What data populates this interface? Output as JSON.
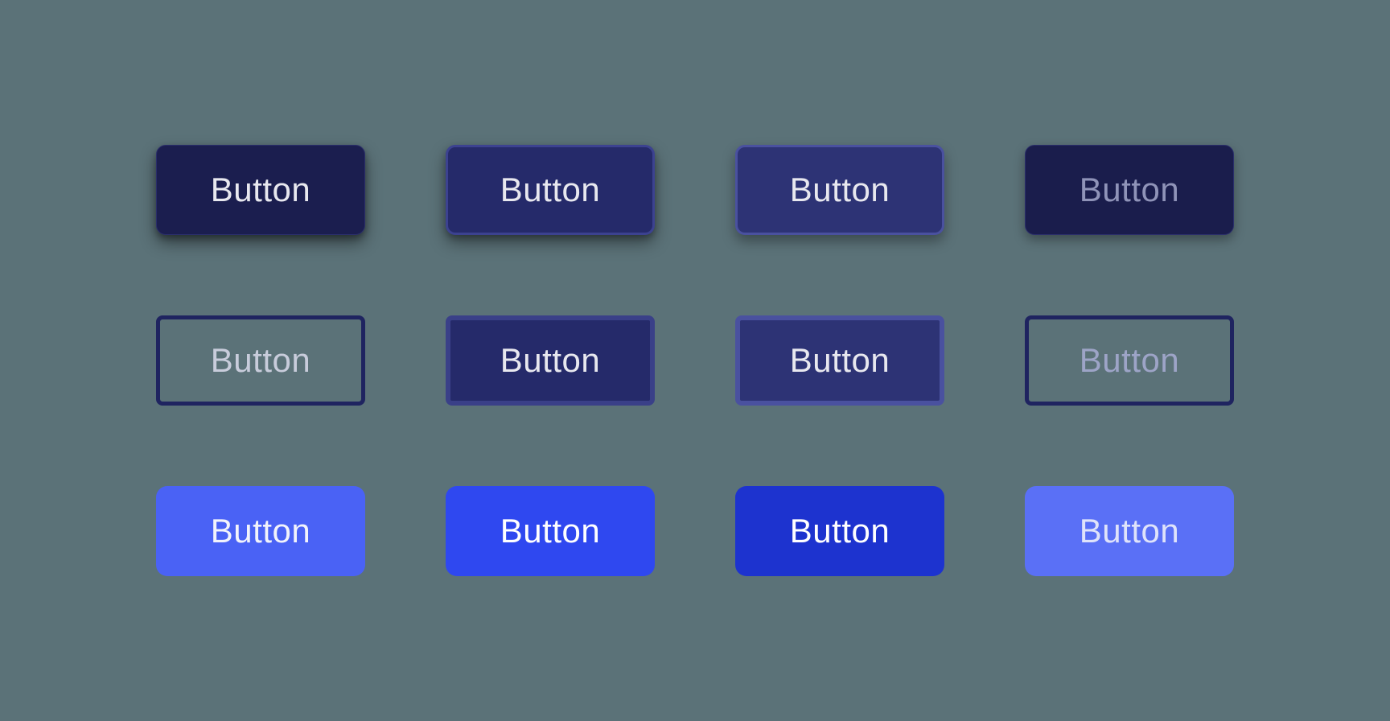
{
  "buttons": {
    "row1": {
      "default": "Button",
      "hover": "Button",
      "active": "Button",
      "disabled": "Button"
    },
    "row2": {
      "default": "Button",
      "hover": "Button",
      "active": "Button",
      "disabled": "Button"
    },
    "row3": {
      "default": "Button",
      "hover": "Button",
      "active": "Button",
      "disabled": "Button"
    }
  },
  "colors": {
    "background": "#5b7278",
    "navy_dark": "#1b1e4f",
    "navy_mid": "#252a6a",
    "navy_light": "#2d3375",
    "blue_bright": "#4a62f5",
    "blue_hover": "#2f48f0",
    "blue_active": "#1d33cf",
    "blue_disabled": "#5a70f6",
    "text_light": "#e8e8ef",
    "text_muted": "#8f93b8"
  }
}
